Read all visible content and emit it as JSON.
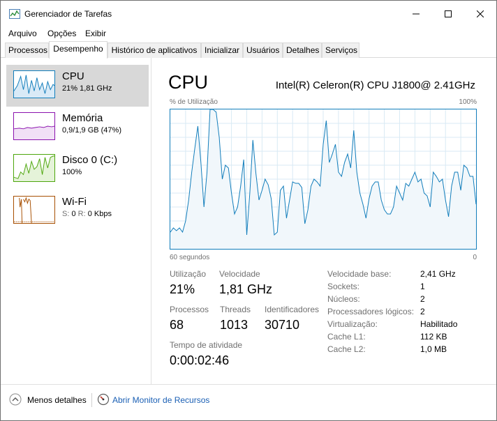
{
  "window": {
    "title": "Gerenciador de Tarefas"
  },
  "menu": {
    "items": [
      "Arquivo",
      "Opções",
      "Exibir"
    ]
  },
  "tabs": [
    "Processos",
    "Desempenho",
    "Histórico de aplicativos",
    "Inicializar",
    "Usuários",
    "Detalhes",
    "Serviços"
  ],
  "active_tab": "Desempenho",
  "sidebar": {
    "items": [
      {
        "title": "CPU",
        "sub": "21% 1,81 GHz"
      },
      {
        "title": "Memória",
        "sub": "0,9/1,9 GB (47%)"
      },
      {
        "title": "Disco 0 (C:)",
        "sub": "100%"
      },
      {
        "title": "Wi-Fi",
        "sub_send_label": "S:",
        "sub_send": "0",
        "sub_recv_label": "R:",
        "sub_recv": "0 Kbps"
      }
    ]
  },
  "cpu": {
    "title": "CPU",
    "model": "Intel(R) Celeron(R) CPU J1800@ 2.41GHz",
    "graph_label": "% de Utilização",
    "graph_max": "100%",
    "graph_time": "60 segundos",
    "graph_min": "0",
    "stats": {
      "utilizacao_label": "Utilização",
      "utilizacao": "21%",
      "velocidade_label": "Velocidade",
      "velocidade": "1,81 GHz",
      "processos_label": "Processos",
      "processos": "68",
      "threads_label": "Threads",
      "threads": "1013",
      "identificadores_label": "Identificadores",
      "identificadores": "30710",
      "tempo_label": "Tempo de atividade",
      "tempo": "0:00:02:46"
    },
    "info": [
      {
        "label": "Velocidade base:",
        "value": "2,41 GHz"
      },
      {
        "label": "Sockets:",
        "value": "1"
      },
      {
        "label": "Núcleos:",
        "value": "2"
      },
      {
        "label": "Processadores lógicos:",
        "value": "2"
      },
      {
        "label": "Virtualização:",
        "value": "Habilitado"
      },
      {
        "label": "Cache L1:",
        "value": "112 KB"
      },
      {
        "label": "Cache L2:",
        "value": "1,0 MB"
      }
    ]
  },
  "chart_data": {
    "type": "area",
    "x_range": [
      60,
      0
    ],
    "ylim": [
      0,
      100
    ],
    "grid": true,
    "color": "#117dbb",
    "values": [
      12,
      15,
      13,
      15,
      12,
      20,
      35,
      55,
      72,
      88,
      62,
      30,
      55,
      100,
      100,
      98,
      80,
      50,
      60,
      58,
      40,
      25,
      30,
      45,
      64,
      10,
      40,
      78,
      54,
      35,
      42,
      50,
      46,
      36,
      10,
      12,
      42,
      45,
      22,
      35,
      48,
      47,
      47,
      44,
      18,
      28,
      45,
      50,
      48,
      45,
      75,
      92,
      62,
      68,
      75,
      55,
      52,
      62,
      68,
      58,
      85,
      55,
      40,
      32,
      22,
      36,
      45,
      48,
      48,
      35,
      28,
      25,
      25,
      30,
      45,
      40,
      35,
      47,
      45,
      50,
      55,
      48,
      50,
      40,
      38,
      30,
      55,
      52,
      48,
      50,
      35,
      23,
      45,
      55,
      55,
      42,
      60,
      58,
      52,
      52,
      32
    ]
  }
}
